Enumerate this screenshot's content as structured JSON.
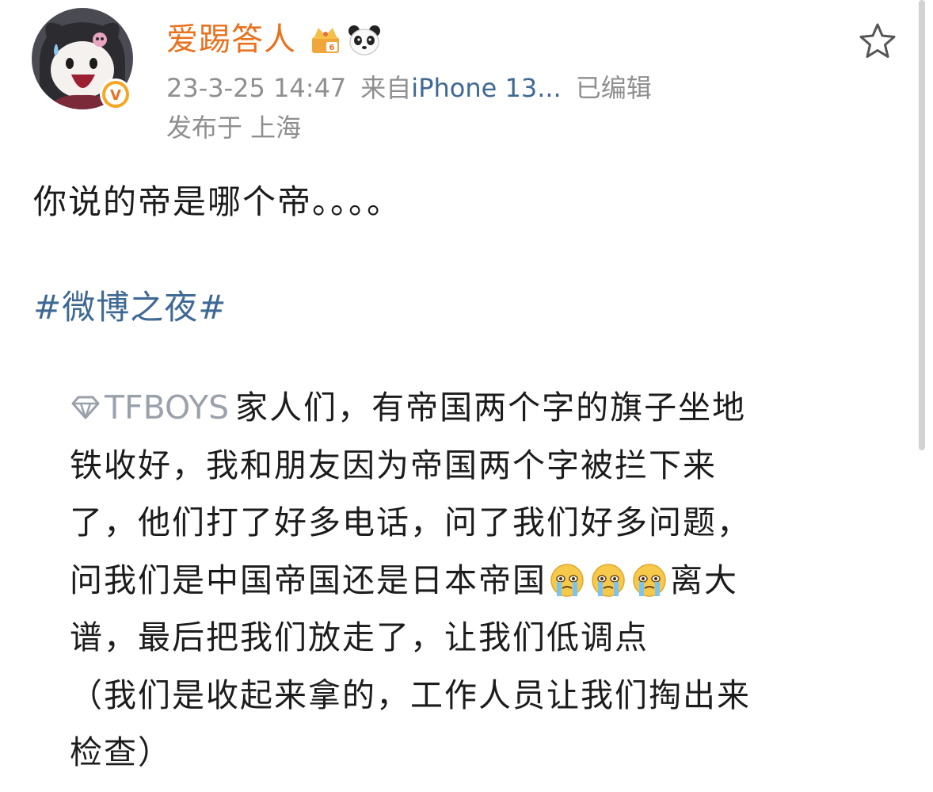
{
  "header": {
    "username": "爱踢答人",
    "timestamp": "23-3-25 14:47",
    "source_prefix": "来自",
    "source_device": "iPhone 13...",
    "edited": "已编辑",
    "location": "发布于 上海",
    "avatar_icon": "kuromi-avatar",
    "verified_icon": "verified-v-badge",
    "member_badge_icon": "crown-vip-badge",
    "panda_badge_icon": "panda-badge",
    "favorite_icon": "star-outline-icon"
  },
  "post": {
    "text": "你说的帝是哪个帝。。。。",
    "hashtag": "#微博之夜#"
  },
  "quote": {
    "tag_icon": "diamond-icon",
    "tag_name": "TFBOYS",
    "lines": [
      "家人们，有帝国两个字的旗子坐地",
      "铁收好，我和朋友因为帝国两个字被拦下来",
      "了，他们打了好多电话，问了我们好多问题，",
      "问我们是中国帝国还是日本帝国",
      "离大",
      "谱，最后把我们放走了，让我们低调点",
      "（我们是收起来拿的，工作人员让我们掏出来",
      "检查）"
    ],
    "emoji_icon": "crying-face-emoji",
    "emoji_count": 3
  },
  "colors": {
    "username": "#e8721f",
    "link": "#3f6995",
    "meta": "#8f8f8f",
    "text": "#1b1b1b",
    "tag_name": "#9aa1ab"
  }
}
